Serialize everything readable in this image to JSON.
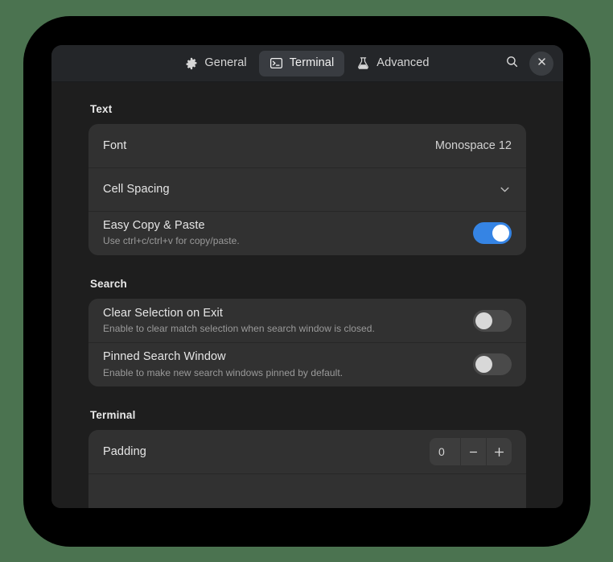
{
  "window": {
    "headerbar": {
      "tabs": [
        {
          "label": "General",
          "icon": "gear-icon",
          "selected": false
        },
        {
          "label": "Terminal",
          "icon": "terminal-icon",
          "selected": true
        },
        {
          "label": "Advanced",
          "icon": "flask-icon",
          "selected": false
        }
      ],
      "search_button": "search-icon",
      "close_button": "close-icon"
    },
    "groups": [
      {
        "title": "Text",
        "rows": [
          {
            "type": "value",
            "title": "Font",
            "value": "Monospace 12"
          },
          {
            "type": "expander",
            "title": "Cell Spacing",
            "icon": "chevron-down-icon"
          },
          {
            "type": "switch",
            "title": "Easy Copy & Paste",
            "subtitle": "Use ctrl+c/ctrl+v for copy/paste.",
            "on": true
          }
        ]
      },
      {
        "title": "Search",
        "rows": [
          {
            "type": "switch",
            "title": "Clear Selection on Exit",
            "subtitle": "Enable to clear match selection when search window is closed.",
            "on": false
          },
          {
            "type": "switch",
            "title": "Pinned Search Window",
            "subtitle": "Enable to make new search windows pinned by default.",
            "on": false
          }
        ]
      },
      {
        "title": "Terminal",
        "rows": [
          {
            "type": "spin",
            "title": "Padding",
            "value": "0",
            "minus_label": "−",
            "plus_label": "+"
          }
        ]
      }
    ]
  },
  "colors": {
    "desktop_background": "#4b7350",
    "device_frame": "#000000",
    "window_background": "#1e1e1e",
    "headerbar_background": "#242629",
    "card_background": "#313131",
    "accent_blue": "#3584e4",
    "switch_off": "#4a4a4a"
  }
}
